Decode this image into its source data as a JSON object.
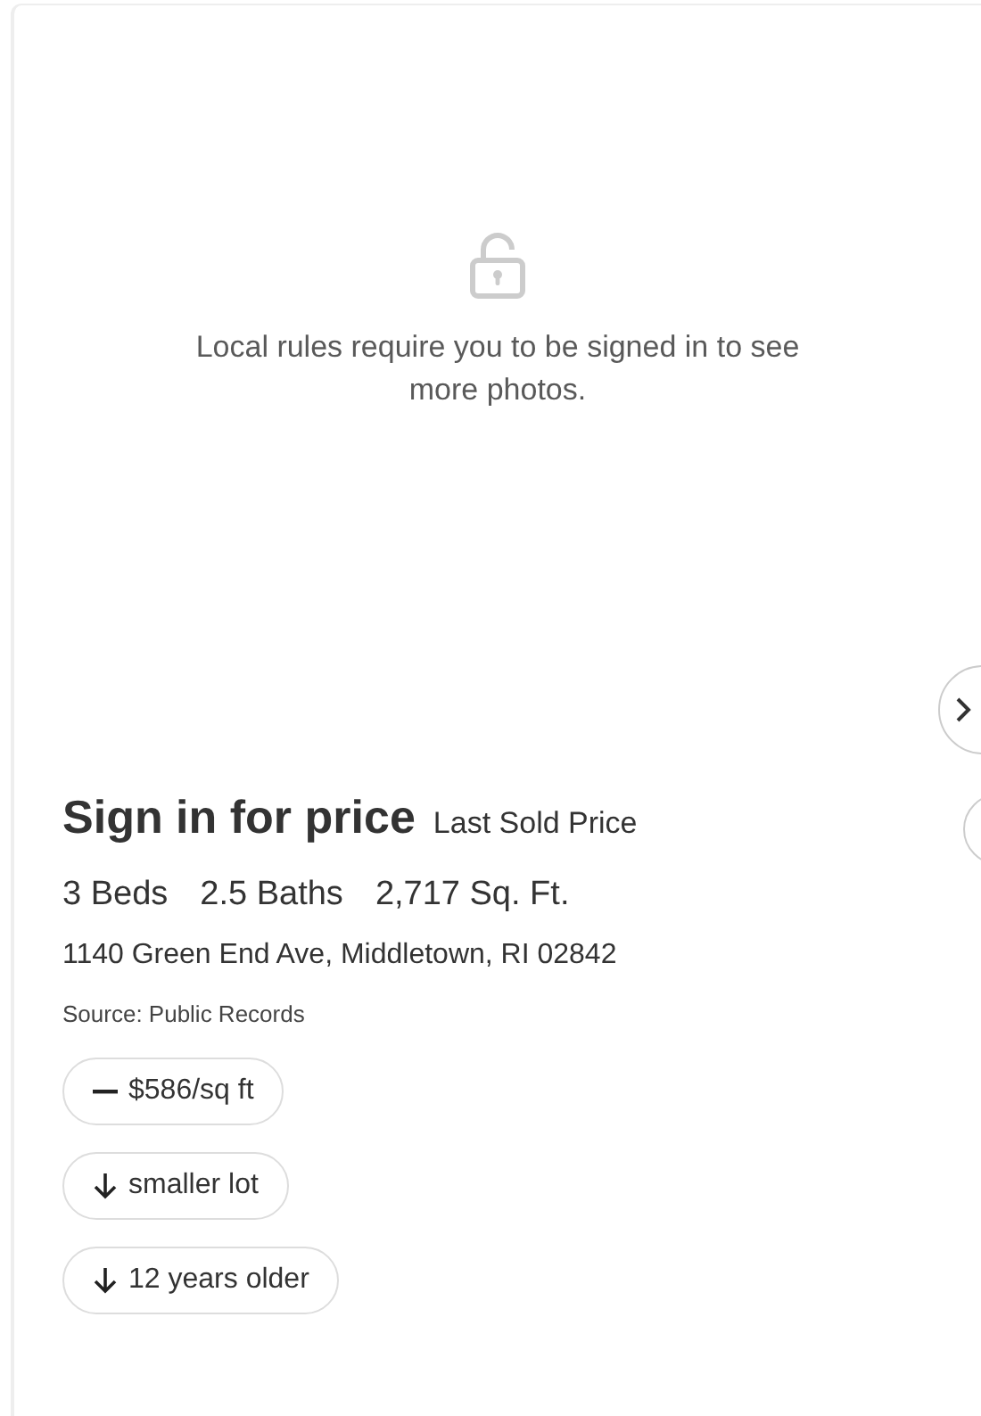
{
  "photo_gate": {
    "message": "Local rules require you to be signed in to see more photos."
  },
  "price": {
    "title": "Sign in for price",
    "label": "Last Sold Price"
  },
  "stats": [
    "3 Beds",
    "2.5 Baths",
    "2,717 Sq. Ft."
  ],
  "address": "1140 Green End Ave, Middletown, RI 02842",
  "source": "Source: Public Records",
  "insights": [
    {
      "kind": "neutral",
      "text": "$586/sq ft"
    },
    {
      "kind": "down",
      "text": "smaller lot"
    },
    {
      "kind": "down",
      "text": "12 years older"
    }
  ]
}
